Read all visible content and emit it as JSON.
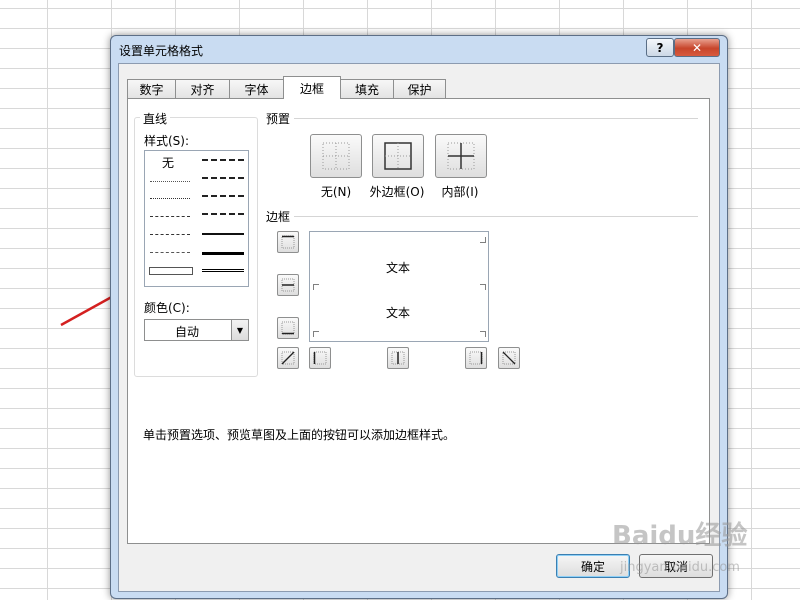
{
  "dialog": {
    "title": "设置单元格格式",
    "help_label": "?",
    "close_label": "✕",
    "tabs": [
      {
        "label": "数字"
      },
      {
        "label": "对齐"
      },
      {
        "label": "字体"
      },
      {
        "label": "边框",
        "active": true
      },
      {
        "label": "填充"
      },
      {
        "label": "保护"
      }
    ],
    "line_group": {
      "title": "直线",
      "style_label": "样式(S):",
      "none_label": "无",
      "color_label": "颜色(C):",
      "color_value": "自动"
    },
    "presets": {
      "title": "预置",
      "none_label": "无(N)",
      "outline_label": "外边框(O)",
      "inside_label": "内部(I)"
    },
    "border": {
      "title": "边框",
      "preview_text_top": "文本",
      "preview_text_bottom": "文本"
    },
    "hint": "单击预置选项、预览草图及上面的按钮可以添加边框样式。",
    "ok_label": "确定",
    "cancel_label": "取消"
  },
  "watermark": {
    "logo": "Baidu经验",
    "url": "jingyan.baidu.com"
  },
  "colors": {
    "arrow": "#d42020",
    "title_bar": "#c9dcf2",
    "close": "#c7452b"
  }
}
